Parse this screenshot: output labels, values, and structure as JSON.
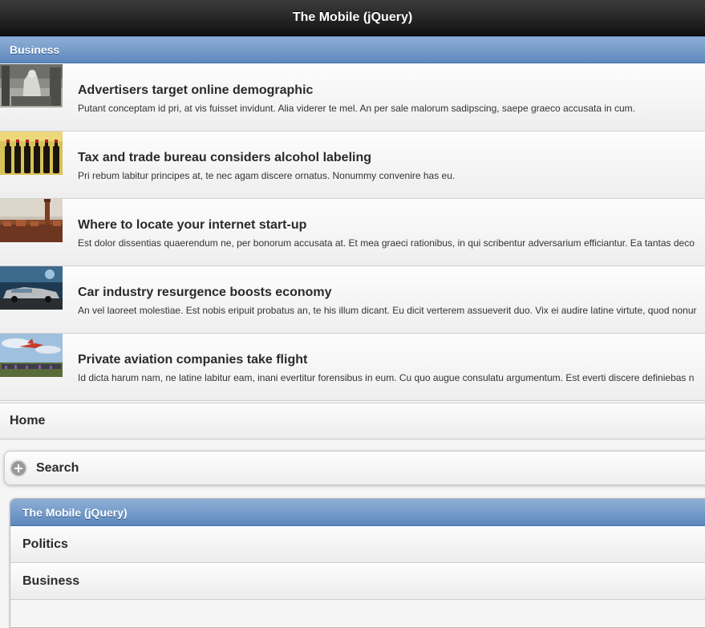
{
  "header": {
    "title": "The Mobile (jQuery)"
  },
  "section": {
    "title": "Business"
  },
  "articles": [
    {
      "title": "Advertisers target online demographic",
      "desc": "Putant conceptam id pri, at vis fuisset invidunt. Alia viderer te mel. An per sale malorum sadipscing, saepe graeco accusata in cum.",
      "thumb_icon": "building-statue-photo"
    },
    {
      "title": "Tax and trade bureau considers alcohol labeling",
      "desc": "Pri rebum labitur principes at, te nec agam discere ornatus. Nonummy convenire has eu.",
      "thumb_icon": "wine-bottles-photo"
    },
    {
      "title": "Where to locate your internet start-up",
      "desc": "Est dolor dissentias quaerendum ne, per bonorum accusata at. Et mea graeci rationibus, in qui scribentur adversarium efficiantur. Ea tantas deco",
      "thumb_icon": "city-skyline-photo"
    },
    {
      "title": "Car industry resurgence boosts economy",
      "desc": "An vel laoreet molestiae. Est nobis eripuit probatus an, te his illum dicant. Eu dicit verterem assueverit duo. Vix ei audire latine virtute, quod nonur",
      "thumb_icon": "classic-car-photo"
    },
    {
      "title": "Private aviation companies take flight",
      "desc": "Id dicta harum nam, ne latine labitur eam, inani evertitur forensibus in eum. Cu quo augue consulatu argumentum. Est everti discere definiebas n",
      "thumb_icon": "airshow-plane-photo"
    }
  ],
  "nav": {
    "home": "Home"
  },
  "search": {
    "label": "Search",
    "icon": "plus-circle-icon"
  },
  "panel": {
    "title": "The Mobile (jQuery)",
    "items": [
      "Politics",
      "Business"
    ]
  }
}
